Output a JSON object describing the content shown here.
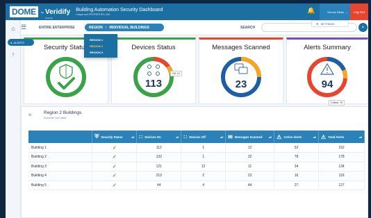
{
  "header": {
    "brand": "DOME",
    "by": "by",
    "company": "Veridify",
    "company_sub": "Security",
    "app_title": "Building Automation Security Dashboard",
    "app_subtitle": "Unique and PROPERTIES, INC.",
    "user": "Dennis Rikter",
    "logout": "Log Out"
  },
  "settings_label": "SETTINGS",
  "alerts_pill": "ALERTS",
  "breadcrumb": {
    "enterprise": "ENTIRE ENTERPRISE",
    "region": "REGION",
    "current": "INDIVIDUAL BUILDINGS"
  },
  "search": {
    "label": "SEARCH",
    "placeholder": ""
  },
  "region_dropdown": [
    "REGION 1",
    "REGION 2",
    "REGION 3"
  ],
  "cards": {
    "security": {
      "title": "Security Status"
    },
    "devices": {
      "title": "Devices Status",
      "value": "113",
      "badge": "Off: 15"
    },
    "messages": {
      "title": "Messages Scanned",
      "value": "23"
    },
    "alerts": {
      "title": "Alerts Summary",
      "value": "94",
      "badge": "Critical: 75"
    }
  },
  "panel": {
    "title": "Region 2 Buildings",
    "subtitle": "Submeter not Linked"
  },
  "table": {
    "headers": [
      {
        "label": "",
        "icon": ""
      },
      {
        "label": "Security Status",
        "icon": "shield-icon"
      },
      {
        "label": "Devices On",
        "icon": "devices-icon"
      },
      {
        "label": "Devices Off",
        "icon": "devices-icon"
      },
      {
        "label": "Messages Scanned",
        "icon": "message-icon"
      },
      {
        "label": "Active Alerts",
        "icon": "warning-icon"
      },
      {
        "label": "Total Alerts",
        "icon": "warning-icon"
      }
    ],
    "rows": [
      {
        "name": "Building 1",
        "devices_on": "112",
        "devices_off": "1",
        "messages": "12",
        "active": "52",
        "total": "152"
      },
      {
        "name": "Building 2",
        "devices_on": "132",
        "devices_off": "1",
        "messages": "32",
        "active": "78",
        "total": "178"
      },
      {
        "name": "Building 3",
        "devices_on": "121",
        "devices_off": "12",
        "messages": "11",
        "active": "34",
        "total": "134"
      },
      {
        "name": "Building 4",
        "devices_on": "213",
        "devices_off": "2",
        "messages": "23",
        "active": "16",
        "total": "116"
      },
      {
        "name": "Building 5",
        "devices_on": "44",
        "devices_off": "4",
        "messages": "44",
        "active": "27",
        "total": "127"
      }
    ]
  },
  "colors": {
    "primary": "#1c6fa3",
    "green": "#3aa34a",
    "red": "#e8452f",
    "orange": "#f5a623",
    "blue": "#1c5fa3"
  }
}
